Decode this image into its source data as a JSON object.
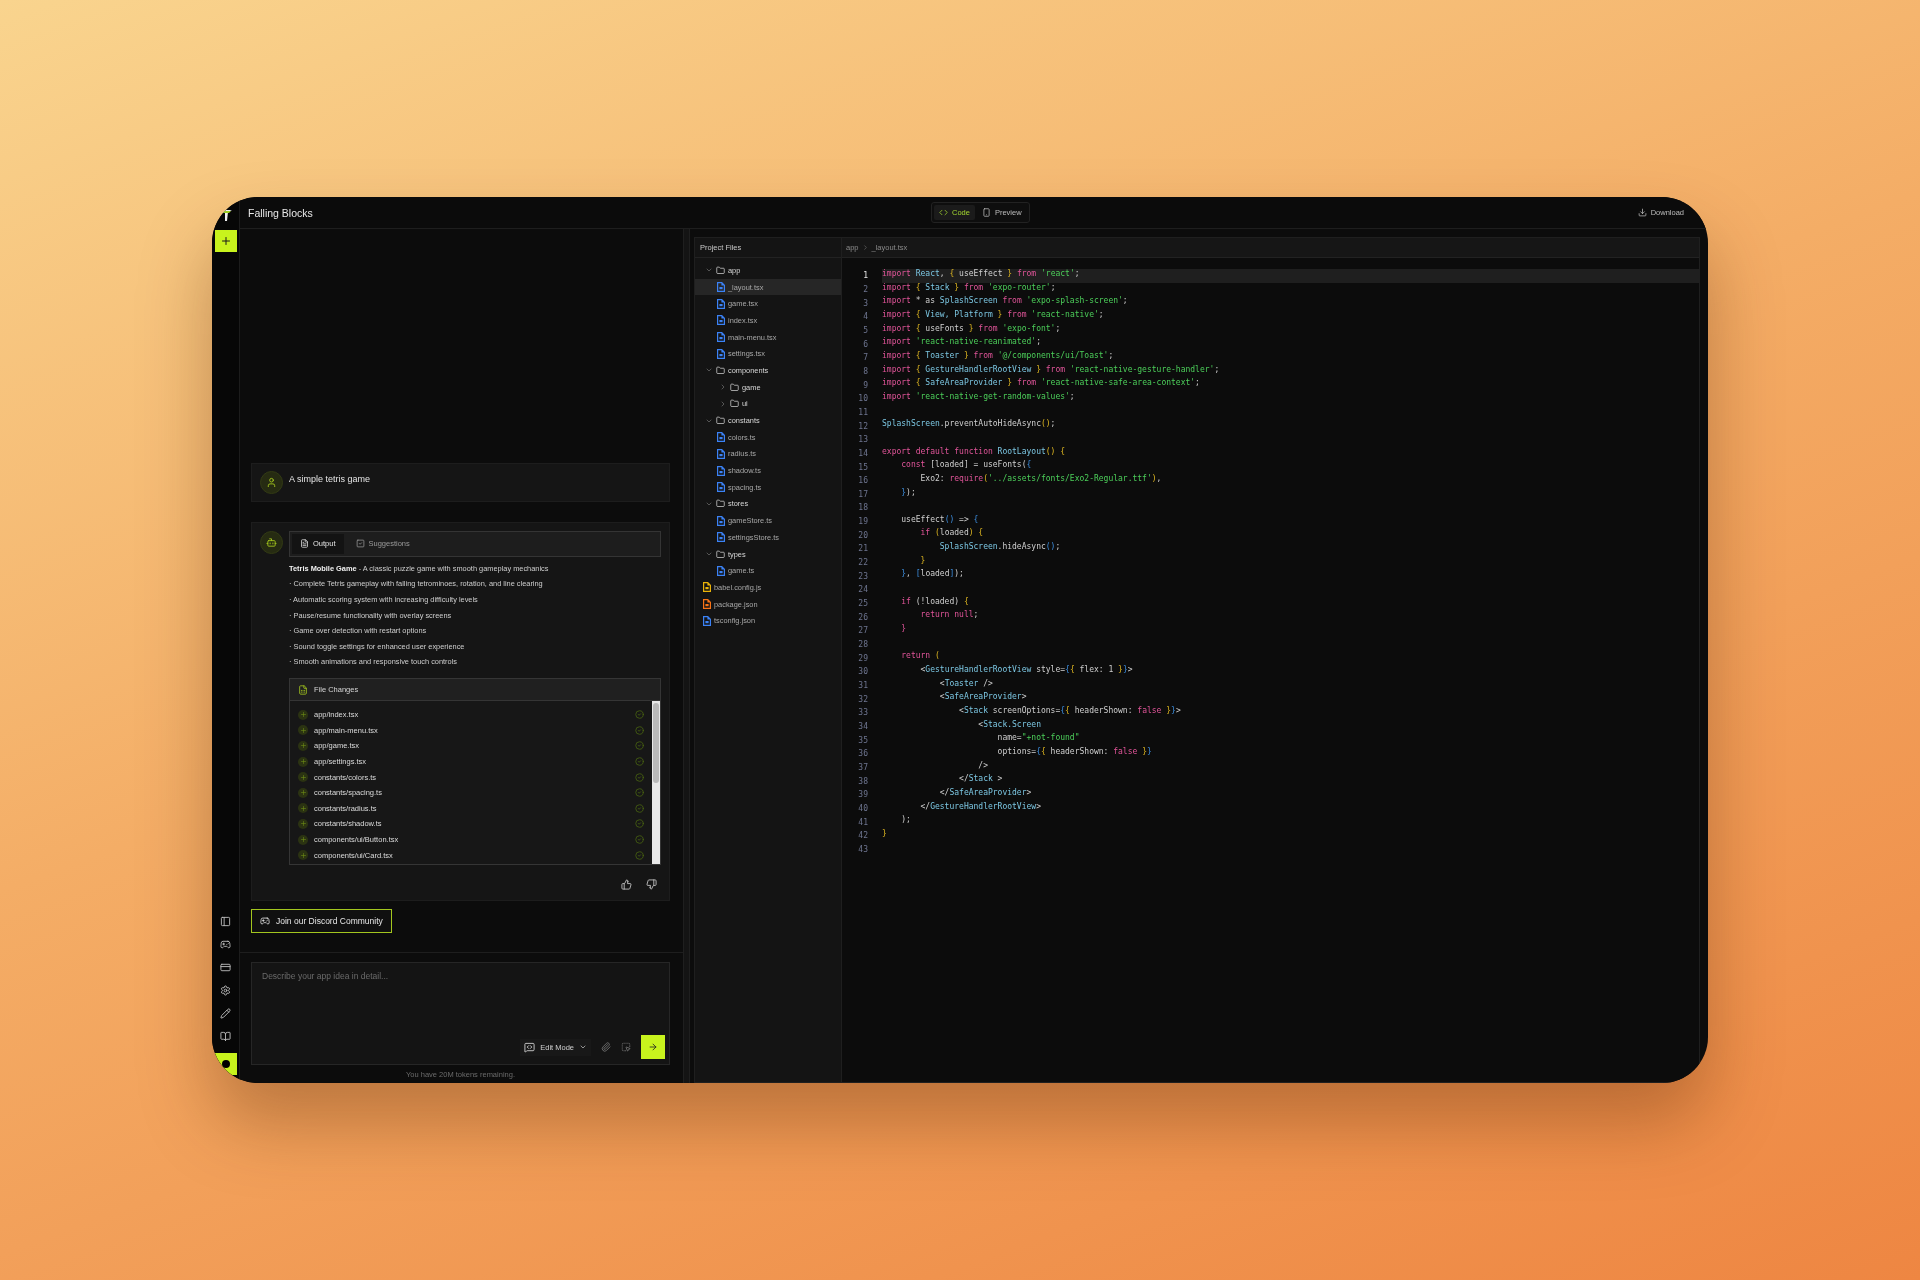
{
  "app": {
    "title": "Falling Blocks"
  },
  "chat": {
    "messages": [
      {
        "kind": "user",
        "text": "A simple tetris game"
      },
      {
        "kind": "assistant",
        "tabs": [
          {
            "label": "Output",
            "selected": true
          },
          {
            "label": "Suggestions",
            "selected": false
          }
        ],
        "summary": "**Tetris Mobile Game** - A classic puzzle game with smooth gameplay mechanics",
        "bullets": [
          "· Complete Tetris gameplay with falling tetrominoes, rotation, and line clearing",
          "· Automatic scoring system with increasing difficulty levels",
          "· Pause/resume functionality with overlay screens",
          "· Game over detection with restart options",
          "· Sound toggle settings for enhanced user experience",
          "· Smooth animations and responsive touch controls"
        ],
        "file_changes": {
          "title": "File Changes",
          "files": [
            "app/index.tsx",
            "app/main-menu.tsx",
            "app/game.tsx",
            "app/settings.tsx",
            "constants/colors.ts",
            "constants/spacing.ts",
            "constants/radius.ts",
            "constants/shadow.ts",
            "components/ui/Button.tsx",
            "components/ui/Card.tsx"
          ]
        }
      }
    ],
    "discord_button": "Join our Discord Community",
    "composer": {
      "placeholder": "Describe your app idea in detail...",
      "mode": "Edit Mode"
    },
    "tokens_note": "You have 20M tokens remaining."
  },
  "view_toggle": [
    {
      "label": "Code",
      "selected": true
    },
    {
      "label": "Preview",
      "selected": false
    }
  ],
  "download": "Download",
  "project_files": {
    "title": "Project Files",
    "tree": [
      {
        "kind": "folder",
        "name": "app",
        "expanded": true,
        "selected": false,
        "children": [
          {
            "kind": "file",
            "name": "_layout.tsx",
            "color": "#3b82f6",
            "selected": true
          },
          {
            "kind": "file",
            "name": "game.tsx",
            "color": "#3b82f6",
            "selected": false
          },
          {
            "kind": "file",
            "name": "index.tsx",
            "color": "#3b82f6",
            "selected": false
          },
          {
            "kind": "file",
            "name": "main-menu.tsx",
            "color": "#3b82f6",
            "selected": false
          },
          {
            "kind": "file",
            "name": "settings.tsx",
            "color": "#3b82f6",
            "selected": false
          }
        ]
      },
      {
        "kind": "folder",
        "name": "components",
        "expanded": true,
        "selected": false,
        "children": [
          {
            "kind": "folder",
            "name": "game",
            "expanded": false,
            "selected": false
          },
          {
            "kind": "folder",
            "name": "ui",
            "expanded": false,
            "selected": false
          }
        ]
      },
      {
        "kind": "folder",
        "name": "constants",
        "expanded": true,
        "selected": false,
        "children": [
          {
            "kind": "file",
            "name": "colors.ts",
            "color": "#3b82f6",
            "selected": false
          },
          {
            "kind": "file",
            "name": "radius.ts",
            "color": "#3b82f6",
            "selected": false
          },
          {
            "kind": "file",
            "name": "shadow.ts",
            "color": "#3b82f6",
            "selected": false
          },
          {
            "kind": "file",
            "name": "spacing.ts",
            "color": "#3b82f6",
            "selected": false
          }
        ]
      },
      {
        "kind": "folder",
        "name": "stores",
        "expanded": true,
        "selected": false,
        "children": [
          {
            "kind": "file",
            "name": "gameStore.ts",
            "color": "#3b82f6",
            "selected": false
          },
          {
            "kind": "file",
            "name": "settingsStore.ts",
            "color": "#3b82f6",
            "selected": false
          }
        ]
      },
      {
        "kind": "folder",
        "name": "types",
        "expanded": true,
        "selected": false,
        "children": [
          {
            "kind": "file",
            "name": "game.ts",
            "color": "#3b82f6",
            "selected": false
          }
        ]
      },
      {
        "kind": "file",
        "name": "babel.config.js",
        "color": "#eab308",
        "selected": false
      },
      {
        "kind": "file",
        "name": "package.json",
        "color": "#f97316",
        "selected": false
      },
      {
        "kind": "file",
        "name": "tsconfig.json",
        "color": "#3b82f6",
        "selected": false
      }
    ]
  },
  "breadcrumb": [
    "app",
    "_layout.tsx"
  ],
  "code": {
    "lines": [
      {
        "number": "1",
        "selected": true,
        "segments": [
          {
            "kind": "kw",
            "text": "import "
          },
          {
            "kind": "id",
            "text": "React"
          },
          {
            "kind": "plain",
            "text": ", "
          },
          {
            "kind": "b",
            "text": "{"
          },
          {
            "kind": "plain",
            "text": " useEffect "
          },
          {
            "kind": "b",
            "text": "}"
          },
          {
            "kind": "kw",
            "text": " from "
          },
          {
            "kind": "str",
            "text": "'react'"
          },
          {
            "kind": "plain",
            "text": ";"
          }
        ]
      },
      {
        "number": "2",
        "selected": false,
        "segments": [
          {
            "kind": "kw",
            "text": "import "
          },
          {
            "kind": "b",
            "text": "{"
          },
          {
            "kind": "id",
            "text": " Stack "
          },
          {
            "kind": "b",
            "text": "}"
          },
          {
            "kind": "kw",
            "text": " from "
          },
          {
            "kind": "str",
            "text": "'expo-router'"
          },
          {
            "kind": "plain",
            "text": ";"
          }
        ]
      },
      {
        "number": "3",
        "selected": false,
        "segments": [
          {
            "kind": "kw",
            "text": "import "
          },
          {
            "kind": "plain",
            "text": "* as "
          },
          {
            "kind": "id",
            "text": "SplashScreen"
          },
          {
            "kind": "kw",
            "text": " from "
          },
          {
            "kind": "str",
            "text": "'expo-splash-screen'"
          },
          {
            "kind": "plain",
            "text": ";"
          }
        ]
      },
      {
        "number": "4",
        "selected": false,
        "segments": [
          {
            "kind": "kw",
            "text": "import "
          },
          {
            "kind": "b",
            "text": "{"
          },
          {
            "kind": "id",
            "text": " View, Platform "
          },
          {
            "kind": "b",
            "text": "}"
          },
          {
            "kind": "kw",
            "text": " from "
          },
          {
            "kind": "str",
            "text": "'react-native'"
          },
          {
            "kind": "plain",
            "text": ";"
          }
        ]
      },
      {
        "number": "5",
        "selected": false,
        "segments": [
          {
            "kind": "kw",
            "text": "import "
          },
          {
            "kind": "b",
            "text": "{"
          },
          {
            "kind": "plain",
            "text": " useFonts "
          },
          {
            "kind": "b",
            "text": "}"
          },
          {
            "kind": "kw",
            "text": " from "
          },
          {
            "kind": "str",
            "text": "'expo-font'"
          },
          {
            "kind": "plain",
            "text": ";"
          }
        ]
      },
      {
        "number": "6",
        "selected": false,
        "segments": [
          {
            "kind": "kw",
            "text": "import "
          },
          {
            "kind": "str",
            "text": "'react-native-reanimated'"
          },
          {
            "kind": "plain",
            "text": ";"
          }
        ]
      },
      {
        "number": "7",
        "selected": false,
        "segments": [
          {
            "kind": "kw",
            "text": "import "
          },
          {
            "kind": "b",
            "text": "{"
          },
          {
            "kind": "id",
            "text": " Toaster "
          },
          {
            "kind": "b",
            "text": "}"
          },
          {
            "kind": "kw",
            "text": " from "
          },
          {
            "kind": "str",
            "text": "'@/components/ui/Toast'"
          },
          {
            "kind": "plain",
            "text": ";"
          }
        ]
      },
      {
        "number": "8",
        "selected": false,
        "segments": [
          {
            "kind": "kw",
            "text": "import "
          },
          {
            "kind": "b",
            "text": "{"
          },
          {
            "kind": "id",
            "text": " GestureHandlerRootView "
          },
          {
            "kind": "b",
            "text": "}"
          },
          {
            "kind": "kw",
            "text": " from "
          },
          {
            "kind": "str",
            "text": "'react-native-gesture-handler'"
          },
          {
            "kind": "plain",
            "text": ";"
          }
        ]
      },
      {
        "number": "9",
        "selected": false,
        "segments": [
          {
            "kind": "kw",
            "text": "import "
          },
          {
            "kind": "b",
            "text": "{"
          },
          {
            "kind": "id",
            "text": " SafeAreaProvider "
          },
          {
            "kind": "b",
            "text": "}"
          },
          {
            "kind": "kw",
            "text": " from "
          },
          {
            "kind": "str",
            "text": "'react-native-safe-area-context'"
          },
          {
            "kind": "plain",
            "text": ";"
          }
        ]
      },
      {
        "number": "10",
        "selected": false,
        "segments": [
          {
            "kind": "kw",
            "text": "import "
          },
          {
            "kind": "str",
            "text": "'react-native-get-random-values'"
          },
          {
            "kind": "plain",
            "text": ";"
          }
        ]
      },
      {
        "number": "11",
        "selected": false
      },
      {
        "number": "12",
        "selected": false,
        "segments": [
          {
            "kind": "id",
            "text": "SplashScreen"
          },
          {
            "kind": "plain",
            "text": ".preventAutoHideAsync"
          },
          {
            "kind": "b",
            "text": "()"
          },
          {
            "kind": "plain",
            "text": ";"
          }
        ]
      },
      {
        "number": "13",
        "selected": false
      },
      {
        "number": "14",
        "selected": false,
        "segments": [
          {
            "kind": "kw",
            "text": "export default function "
          },
          {
            "kind": "id",
            "text": "RootLayout"
          },
          {
            "kind": "b",
            "text": "() {"
          }
        ]
      },
      {
        "number": "15",
        "selected": false,
        "segments": [
          {
            "kind": "kw",
            "text": "    const "
          },
          {
            "kind": "plain",
            "text": "[loaded] = useFonts("
          },
          {
            "kind": "b2",
            "text": "{"
          }
        ]
      },
      {
        "number": "16",
        "selected": false,
        "segments": [
          {
            "kind": "plain",
            "text": "        Exo2: "
          },
          {
            "kind": "kw",
            "text": "require"
          },
          {
            "kind": "b",
            "text": "("
          },
          {
            "kind": "str",
            "text": "'../assets/fonts/Exo2-Regular.ttf'"
          },
          {
            "kind": "b",
            "text": ")"
          },
          {
            "kind": "plain",
            "text": ","
          }
        ]
      },
      {
        "number": "17",
        "selected": false,
        "segments": [
          {
            "kind": "b2",
            "text": "    }"
          },
          {
            "kind": "plain",
            "text": ");"
          }
        ]
      },
      {
        "number": "18",
        "selected": false
      },
      {
        "number": "19",
        "selected": false,
        "segments": [
          {
            "kind": "plain",
            "text": "    useEffect"
          },
          {
            "kind": "b2",
            "text": "()"
          },
          {
            "kind": "plain",
            "text": " => "
          },
          {
            "kind": "b2",
            "text": "{"
          }
        ]
      },
      {
        "number": "20",
        "selected": false,
        "segments": [
          {
            "kind": "kw",
            "text": "        if "
          },
          {
            "kind": "b",
            "text": "("
          },
          {
            "kind": "plain",
            "text": "loaded"
          },
          {
            "kind": "b",
            "text": ") {"
          }
        ]
      },
      {
        "number": "21",
        "selected": false,
        "segments": [
          {
            "kind": "id",
            "text": "            SplashScreen"
          },
          {
            "kind": "plain",
            "text": ".hideAsync"
          },
          {
            "kind": "b2",
            "text": "()"
          },
          {
            "kind": "plain",
            "text": ";"
          }
        ]
      },
      {
        "number": "22",
        "selected": false,
        "segments": [
          {
            "kind": "b",
            "text": "        }"
          }
        ]
      },
      {
        "number": "23",
        "selected": false,
        "segments": [
          {
            "kind": "b2",
            "text": "    }"
          },
          {
            "kind": "plain",
            "text": ", "
          },
          {
            "kind": "b2",
            "text": "["
          },
          {
            "kind": "plain",
            "text": "loaded"
          },
          {
            "kind": "b2",
            "text": "]"
          },
          {
            "kind": "plain",
            "text": ");"
          }
        ]
      },
      {
        "number": "24",
        "selected": false
      },
      {
        "number": "25",
        "selected": false,
        "segments": [
          {
            "kind": "kw",
            "text": "    if "
          },
          {
            "kind": "plain",
            "text": "(!loaded) "
          },
          {
            "kind": "b",
            "text": "{"
          }
        ]
      },
      {
        "number": "26",
        "selected": false,
        "segments": [
          {
            "kind": "kw",
            "text": "        return null"
          },
          {
            "kind": "plain",
            "text": ";"
          }
        ]
      },
      {
        "number": "27",
        "selected": false,
        "segments": [
          {
            "kind": "kw",
            "text": "    }"
          }
        ]
      },
      {
        "number": "28",
        "selected": false
      },
      {
        "number": "29",
        "selected": false,
        "segments": [
          {
            "kind": "kw",
            "text": "    return "
          },
          {
            "kind": "b",
            "text": "("
          }
        ]
      },
      {
        "number": "30",
        "selected": false,
        "segments": [
          {
            "kind": "plain",
            "text": "        <"
          },
          {
            "kind": "id",
            "text": "GestureHandlerRootView"
          },
          {
            "kind": "plain",
            "text": " style="
          },
          {
            "kind": "b2",
            "text": "{"
          },
          {
            "kind": "b",
            "text": "{"
          },
          {
            "kind": "plain",
            "text": " flex: 1 "
          },
          {
            "kind": "b",
            "text": "}"
          },
          {
            "kind": "b2",
            "text": "}"
          },
          {
            "kind": "plain",
            "text": ">"
          }
        ]
      },
      {
        "number": "31",
        "selected": false,
        "segments": [
          {
            "kind": "plain",
            "text": "            <"
          },
          {
            "kind": "id",
            "text": "Toaster"
          },
          {
            "kind": "plain",
            "text": " />"
          }
        ]
      },
      {
        "number": "32",
        "selected": false,
        "segments": [
          {
            "kind": "plain",
            "text": "            <"
          },
          {
            "kind": "id",
            "text": "SafeAreaProvider"
          },
          {
            "kind": "plain",
            "text": ">"
          }
        ]
      },
      {
        "number": "33",
        "selected": false,
        "segments": [
          {
            "kind": "plain",
            "text": "                <"
          },
          {
            "kind": "id",
            "text": "Stack"
          },
          {
            "kind": "plain",
            "text": " screenOptions="
          },
          {
            "kind": "b2",
            "text": "{"
          },
          {
            "kind": "b",
            "text": "{"
          },
          {
            "kind": "plain",
            "text": " headerShown: "
          },
          {
            "kind": "kw",
            "text": "false "
          },
          {
            "kind": "b",
            "text": "}"
          },
          {
            "kind": "b2",
            "text": "}"
          },
          {
            "kind": "plain",
            "text": ">"
          }
        ]
      },
      {
        "number": "34",
        "selected": false,
        "segments": [
          {
            "kind": "plain",
            "text": "                    <"
          },
          {
            "kind": "id",
            "text": "Stack.Screen"
          }
        ]
      },
      {
        "number": "35",
        "selected": false,
        "segments": [
          {
            "kind": "plain",
            "text": "                        name="
          },
          {
            "kind": "str",
            "text": "\"+not-found\""
          }
        ]
      },
      {
        "number": "36",
        "selected": false,
        "segments": [
          {
            "kind": "plain",
            "text": "                        options="
          },
          {
            "kind": "b2",
            "text": "{"
          },
          {
            "kind": "b",
            "text": "{"
          },
          {
            "kind": "plain",
            "text": " headerShown: "
          },
          {
            "kind": "kw",
            "text": "false "
          },
          {
            "kind": "b",
            "text": "}"
          },
          {
            "kind": "b2",
            "text": "}"
          }
        ]
      },
      {
        "number": "37",
        "selected": false,
        "segments": [
          {
            "kind": "plain",
            "text": "                    />"
          }
        ]
      },
      {
        "number": "38",
        "selected": false,
        "segments": [
          {
            "kind": "plain",
            "text": "                </"
          },
          {
            "kind": "id",
            "text": "Stack"
          },
          {
            "kind": "plain",
            "text": " >"
          }
        ]
      },
      {
        "number": "39",
        "selected": false,
        "segments": [
          {
            "kind": "plain",
            "text": "            </"
          },
          {
            "kind": "id",
            "text": "SafeAreaProvider"
          },
          {
            "kind": "plain",
            "text": ">"
          }
        ]
      },
      {
        "number": "40",
        "selected": false,
        "segments": [
          {
            "kind": "plain",
            "text": "        </"
          },
          {
            "kind": "id",
            "text": "GestureHandlerRootView"
          },
          {
            "kind": "plain",
            "text": ">"
          }
        ]
      },
      {
        "number": "41",
        "selected": false,
        "segments": [
          {
            "kind": "plain",
            "text": "    );"
          }
        ]
      },
      {
        "number": "42",
        "selected": false,
        "segments": [
          {
            "kind": "b",
            "text": "}"
          }
        ]
      },
      {
        "number": "43",
        "selected": false
      }
    ]
  }
}
